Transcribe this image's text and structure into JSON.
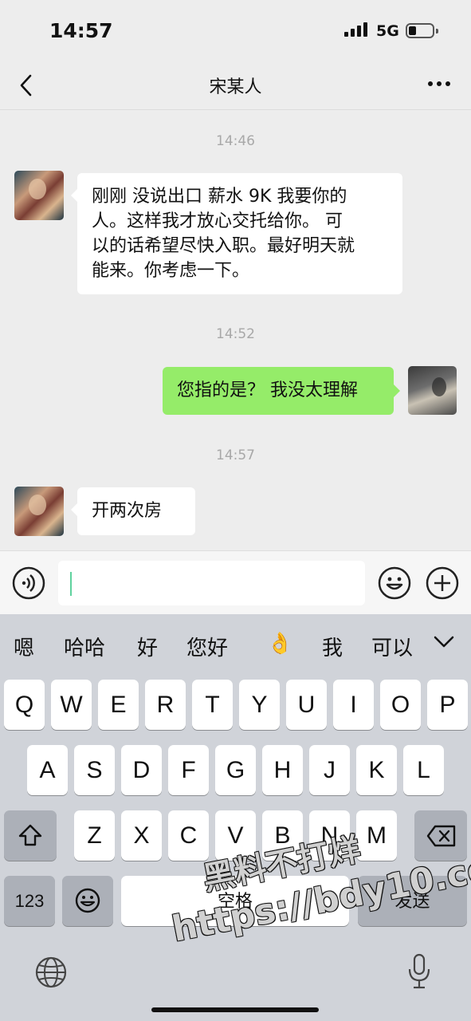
{
  "status_bar": {
    "time": "14:57",
    "network": "5G"
  },
  "nav": {
    "title": "宋某人"
  },
  "messages": [
    {
      "timestamp": "14:46",
      "sender": "contact",
      "text_lines": [
        "刚刚 没说出口 薪水 9K 我要你的",
        "人。这样我才放心交托给你。 可",
        "以的话希望尽快入职。最好明天就",
        "能来。你考虑一下。"
      ]
    },
    {
      "timestamp": "14:52",
      "sender": "me",
      "text": "您指的是？ 我没太理解"
    },
    {
      "timestamp": "14:57",
      "sender": "contact",
      "text": "开两次房"
    }
  ],
  "input": {
    "value": ""
  },
  "keyboard": {
    "suggestions": [
      "嗯",
      "哈哈",
      "好",
      "您好",
      "👌",
      "我",
      "可以"
    ],
    "row1": [
      "Q",
      "W",
      "E",
      "R",
      "T",
      "Y",
      "U",
      "I",
      "O",
      "P"
    ],
    "row2": [
      "A",
      "S",
      "D",
      "F",
      "G",
      "H",
      "J",
      "K",
      "L"
    ],
    "row3": [
      "Z",
      "X",
      "C",
      "V",
      "B",
      "N",
      "M"
    ],
    "numbers_key": "123",
    "space_key": "空格",
    "send_key": "发送"
  },
  "watermark": {
    "line1": "黑料不打烊",
    "line2": "https://bdy10.co"
  }
}
